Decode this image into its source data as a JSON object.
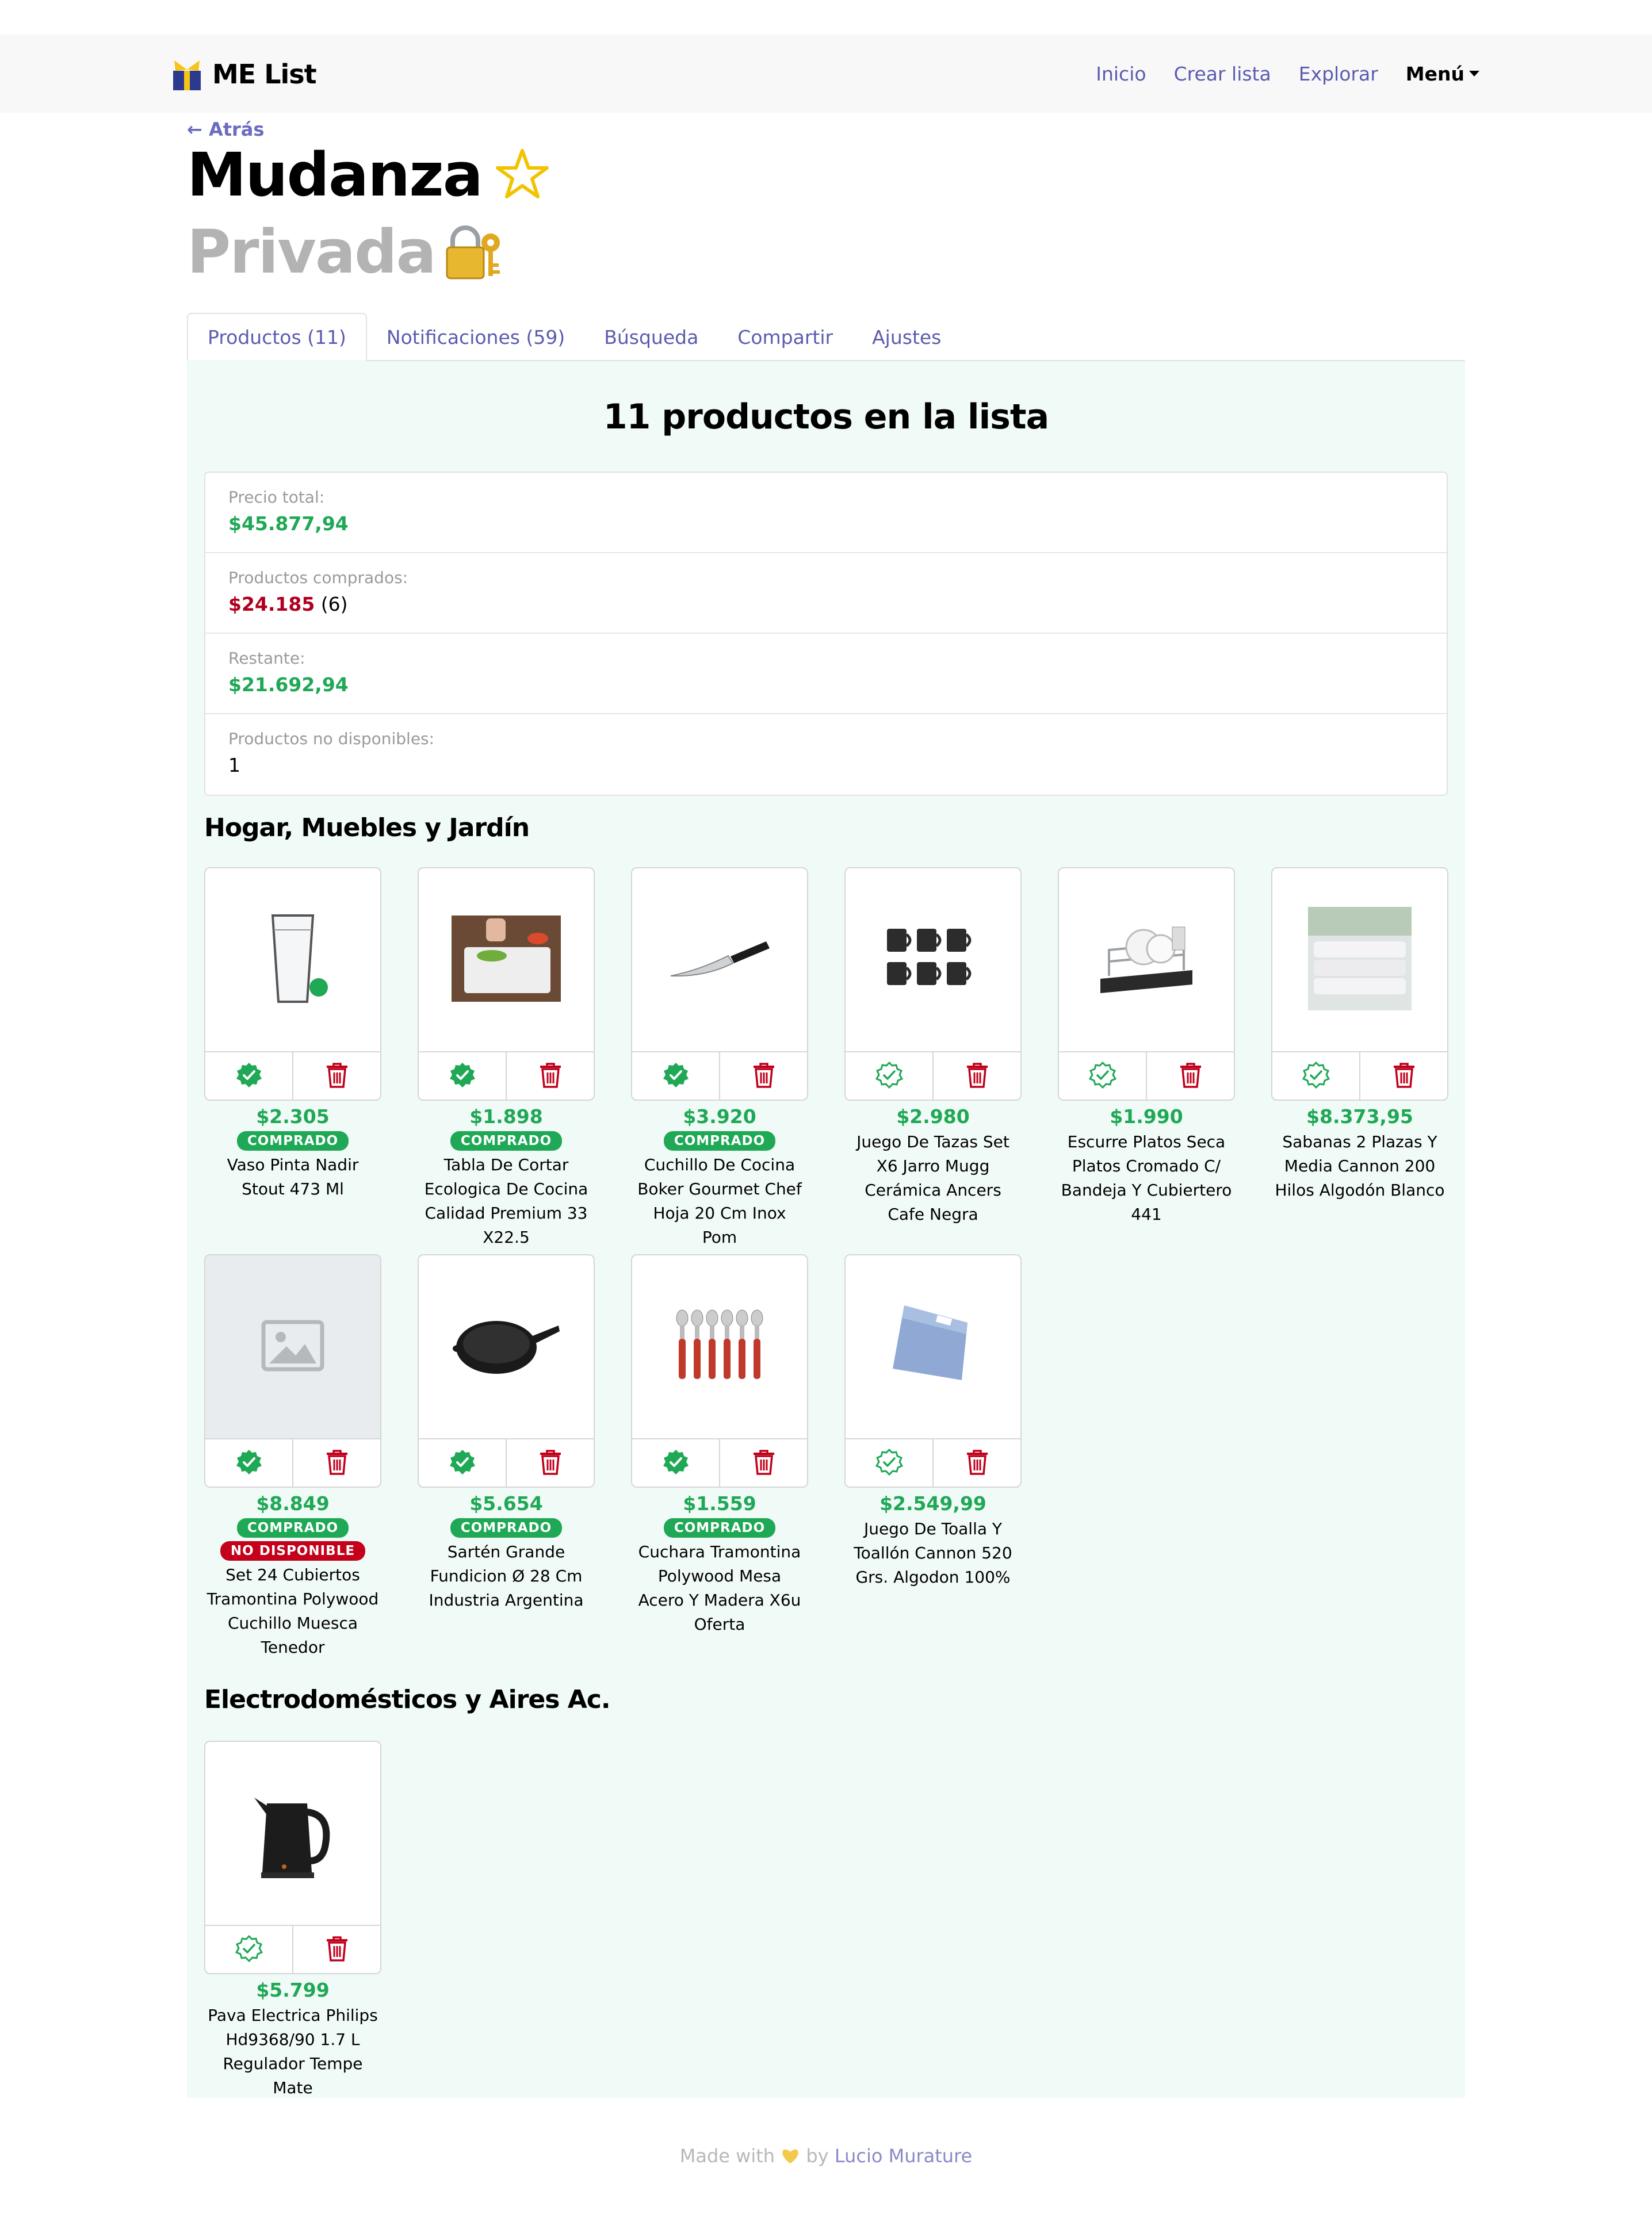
{
  "nav": {
    "brand": "ME List",
    "links": [
      "Inicio",
      "Crear lista",
      "Explorar"
    ],
    "menu": "Menú"
  },
  "header": {
    "back": "← Atrás",
    "title": "Mudanza",
    "subtitle": "Privada"
  },
  "tabs": [
    "Productos (11)",
    "Notificaciones (59)",
    "Búsqueda",
    "Compartir",
    "Ajustes"
  ],
  "summary": {
    "count_title": "11 productos en la lista",
    "total_label": "Precio total:",
    "total_value": "$45.877,94",
    "bought_label": "Productos comprados:",
    "bought_value": "$24.185",
    "bought_count": "(6)",
    "remaining_label": "Restante:",
    "remaining_value": "$21.692,94",
    "unavailable_label": "Productos no disponibles:",
    "unavailable_value": "1"
  },
  "sections": [
    "Hogar, Muebles y Jardín",
    "Electrodomésticos y Aires Ac."
  ],
  "badges": {
    "bought": "COMPRADO",
    "unavailable": "NO DISPONIBLE"
  },
  "products": [
    {
      "price": "$2.305",
      "name": "Vaso Pinta Nadir Stout 473 Ml",
      "bought": true,
      "unavailable": false,
      "icon": "glass-icon"
    },
    {
      "price": "$1.898",
      "name": "Tabla De Cortar Ecologica De Cocina Calidad Premium 33 X22.5",
      "bought": true,
      "unavailable": false,
      "icon": "cutting-board-icon"
    },
    {
      "price": "$3.920",
      "name": "Cuchillo De Cocina Boker Gourmet Chef Hoja 20 Cm Inox Pom",
      "bought": true,
      "unavailable": false,
      "icon": "knife-icon"
    },
    {
      "price": "$2.980",
      "name": "Juego De Tazas Set X6 Jarro Mugg Cerámica Ancers Cafe Negra",
      "bought": false,
      "unavailable": false,
      "icon": "mugs-icon"
    },
    {
      "price": "$1.990",
      "name": "Escurre Platos Seca Platos Cromado C/ Bandeja Y Cubiertero 441",
      "bought": false,
      "unavailable": false,
      "icon": "dish-rack-icon"
    },
    {
      "price": "$8.373,95",
      "name": "Sabanas 2 Plazas Y Media Cannon 200 Hilos Algodón Blanco",
      "bought": false,
      "unavailable": false,
      "icon": "sheets-icon"
    },
    {
      "price": "$8.849",
      "name": "Set 24 Cubiertos Tramontina Polywood Cuchillo Muesca Tenedor",
      "bought": true,
      "unavailable": true,
      "icon": "image-placeholder-icon"
    },
    {
      "price": "$5.654",
      "name": "Sartén Grande Fundicion Ø 28 Cm Industria Argentina",
      "bought": true,
      "unavailable": false,
      "icon": "pan-icon"
    },
    {
      "price": "$1.559",
      "name": "Cuchara Tramontina Polywood Mesa Acero Y Madera X6u Oferta",
      "bought": true,
      "unavailable": false,
      "icon": "spoons-icon"
    },
    {
      "price": "$2.549,99",
      "name": "Juego De Toalla Y Toallón Cannon 520 Grs. Algodon 100%",
      "bought": false,
      "unavailable": false,
      "icon": "towel-icon"
    },
    {
      "price": "$5.799",
      "name": "Pava Electrica Philips Hd9368/90 1.7 L Regulador Tempe Mate",
      "bought": false,
      "unavailable": false,
      "icon": "kettle-icon"
    }
  ],
  "footer": {
    "made_with": "Made with",
    "by": "by",
    "author": "Lucio Murature"
  },
  "colors": {
    "accent": "#5b5bb0",
    "green": "#1fa855",
    "red": "#b00020",
    "panel": "#f0faf6"
  }
}
